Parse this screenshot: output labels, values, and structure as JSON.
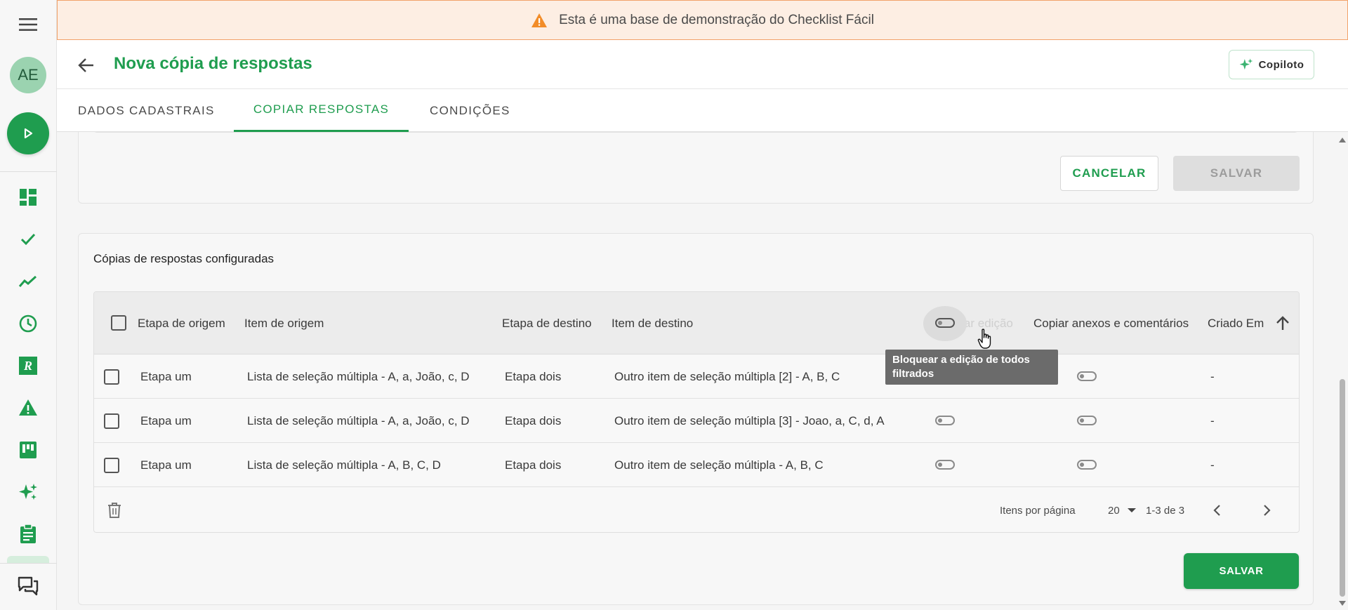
{
  "banner": {
    "text": "Esta é uma base de demonstração do Checklist Fácil",
    "icon": "warning-icon"
  },
  "sidebar": {
    "avatar_initials": "AE",
    "items": [
      {
        "name": "dashboard-icon"
      },
      {
        "name": "checkmark-icon"
      },
      {
        "name": "trending-icon"
      },
      {
        "name": "clock-icon"
      },
      {
        "name": "r-badge-icon"
      },
      {
        "name": "alert-icon"
      },
      {
        "name": "kanban-icon"
      },
      {
        "name": "sparkles-icon"
      },
      {
        "name": "clipboard-icon"
      },
      {
        "name": "chat-icon"
      }
    ]
  },
  "header": {
    "title": "Nova cópia de respostas",
    "copilot_label": "Copiloto"
  },
  "tabs": [
    {
      "label": "DADOS CADASTRAIS",
      "active": false
    },
    {
      "label": "COPIAR RESPOSTAS",
      "active": true
    },
    {
      "label": "CONDIÇÕES",
      "active": false
    }
  ],
  "form_actions": {
    "cancel_label": "CANCELAR",
    "save_label": "SALVAR"
  },
  "configured": {
    "title": "Cópias de respostas configuradas",
    "columns": {
      "source_stage": "Etapa de origem",
      "source_item": "Item de origem",
      "target_stage": "Etapa de destino",
      "target_item": "Item de destino",
      "block_edit": "Bloquear edição",
      "copy_attachments": "Copiar anexos e comentários",
      "created_at": "Criado Em"
    },
    "rows": [
      {
        "source_stage": "Etapa um",
        "source_item": "Lista de seleção múltipla - A, a, João, c, D",
        "target_stage": "Etapa dois",
        "target_item": "Outro item de seleção múltipla [2]  - A, B, C",
        "created_at": "-"
      },
      {
        "source_stage": "Etapa um",
        "source_item": "Lista de seleção múltipla - A, a, João, c, D",
        "target_stage": "Etapa dois",
        "target_item": "Outro item de seleção múltipla [3] - Joao, a, C, d, A",
        "created_at": "-"
      },
      {
        "source_stage": "Etapa um",
        "source_item": "Lista de seleção múltipla - A, B, C, D",
        "target_stage": "Etapa dois",
        "target_item": "Outro item de seleção múltipla - A, B, C",
        "created_at": "-"
      }
    ],
    "pagination": {
      "per_page_label": "Itens por página",
      "per_page_value": "20",
      "range": "1-3 de 3"
    },
    "tooltip": "Bloquear a edição de todos filtrados",
    "save_label": "SALVAR"
  },
  "colors": {
    "accent": "#1f9d4f",
    "banner_bg": "#fdeee3",
    "warning": "#f28c28"
  }
}
